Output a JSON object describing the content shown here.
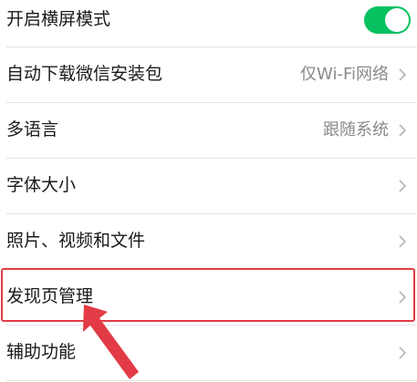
{
  "settings": {
    "items": [
      {
        "label": "开启横屏模式",
        "value": "",
        "control": "toggle",
        "toggle_on": true
      },
      {
        "label": "自动下载微信安装包",
        "value": "仅Wi-Fi网络",
        "control": "chevron"
      },
      {
        "label": "多语言",
        "value": "跟随系统",
        "control": "chevron"
      },
      {
        "label": "字体大小",
        "value": "",
        "control": "chevron"
      },
      {
        "label": "照片、视频和文件",
        "value": "",
        "control": "chevron"
      },
      {
        "label": "发现页管理",
        "value": "",
        "control": "chevron",
        "highlighted": true
      },
      {
        "label": "辅助功能",
        "value": "",
        "control": "chevron"
      }
    ]
  },
  "colors": {
    "toggle_on": "#07c160",
    "highlight_border": "#e23b45",
    "arrow": "#e23b45",
    "value_text": "#8a8a8a",
    "label_text": "#1a1a1a"
  }
}
